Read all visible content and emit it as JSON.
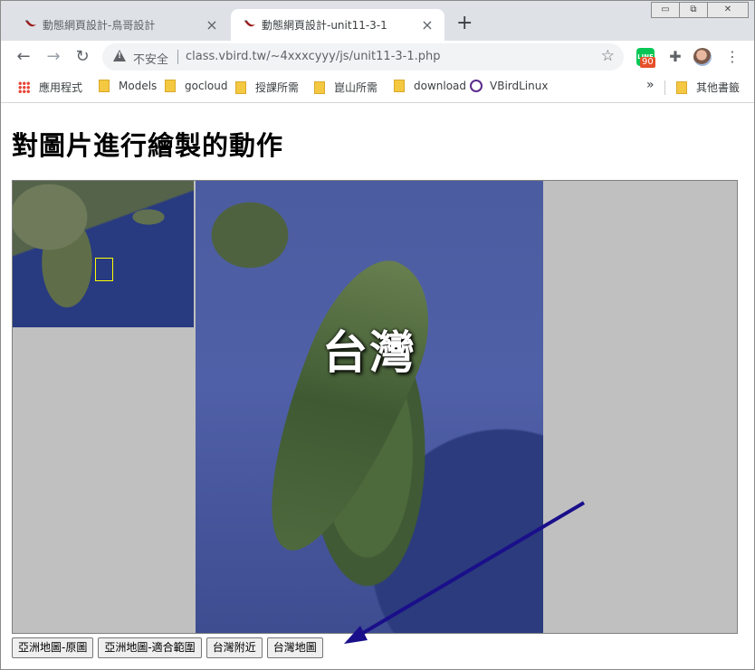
{
  "browser": {
    "tabs": [
      {
        "title": "動態網頁設計-鳥哥設計",
        "active": false
      },
      {
        "title": "動態網頁設計-unit11-3-1",
        "active": true
      }
    ],
    "new_tab_label": "+",
    "tab_close_label": "×",
    "window_controls": [
      "▭",
      "⧉",
      "✕"
    ],
    "security_label": "不安全",
    "url": "class.vbird.tw/~4xxxcyyy/js/unit11-3-1.php",
    "extension_badge": "90",
    "bookmarks": [
      "應用程式",
      "Models",
      "gocloud",
      "授課所需",
      "崑山所需",
      "download",
      "VBirdLinux"
    ],
    "bookmarks_overflow": "»",
    "other_bookmarks": "其他書籤"
  },
  "page": {
    "heading": "對圖片進行繪製的動作",
    "map_label": "台灣",
    "buttons": [
      "亞洲地圖-原圖",
      "亞洲地圖-適合範圍",
      "台灣附近",
      "台灣地圖"
    ]
  },
  "colors": {
    "canvas_bg": "#c0c0c0",
    "arrow": "#1a0f8a",
    "selection_box": "#ffff00"
  },
  "icons": {
    "back": "arrow-left-icon",
    "forward": "arrow-right-icon",
    "reload": "reload-icon",
    "warning": "warning-icon",
    "bookmark": "star-icon",
    "extensions": "puzzle-icon",
    "menu": "kebab-menu-icon"
  }
}
